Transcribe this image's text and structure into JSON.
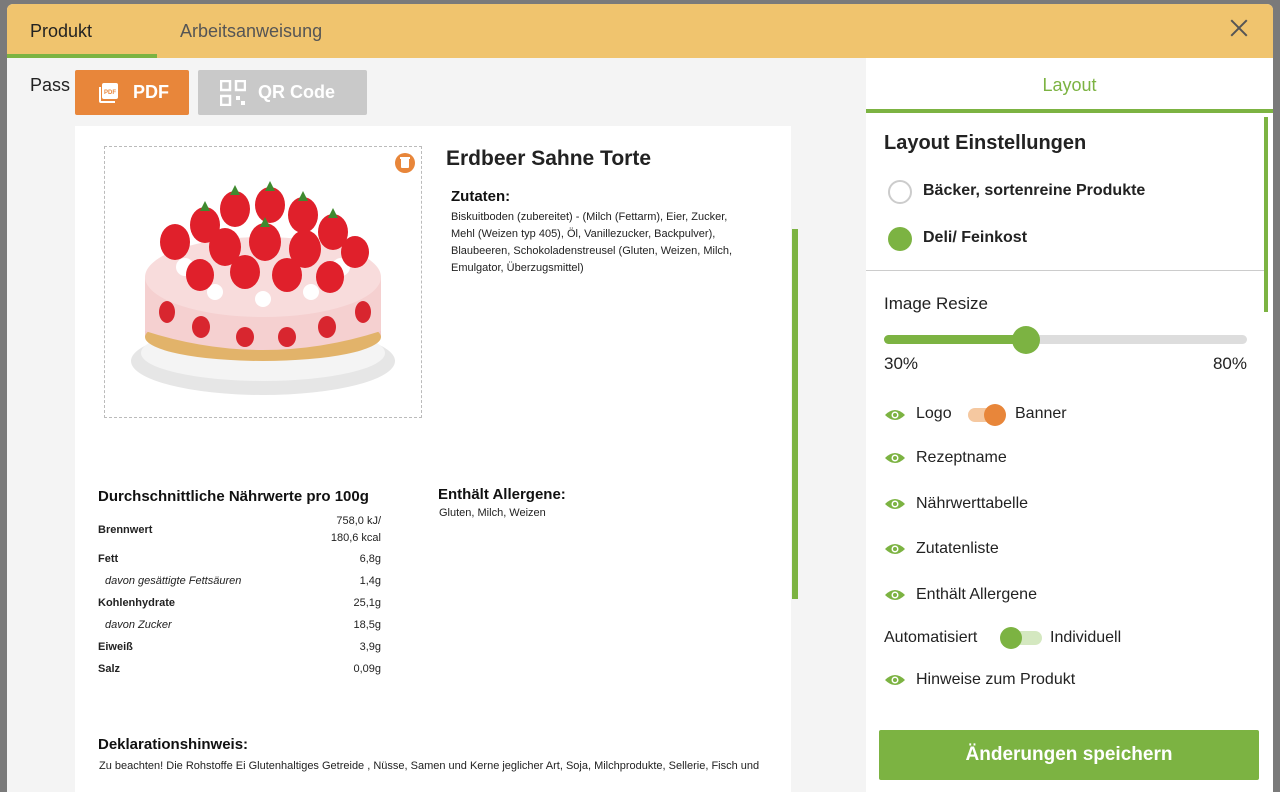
{
  "tabs": {
    "product_pass": "Produkt Pass",
    "work_instruction": "Arbeitsanweisung"
  },
  "toolbar": {
    "pdf_label": "PDF",
    "qr_label": "QR Code"
  },
  "document": {
    "title": "Erdbeer Sahne Torte",
    "ingredients_heading": "Zutaten:",
    "ingredients_text": "Biskuitboden (zubereitet) - (Milch (Fettarm), Eier, Zucker, Mehl (Weizen typ 405), Öl, Vanillezucker, Backpulver), Blaubeeren, Schokoladenstreusel (Gluten, Weizen, Milch, Emulgator, Überzugsmittel)",
    "nutrition_heading": "Durchschnittliche Nährwerte pro 100g",
    "nutrition_rows": [
      {
        "label": "Brennwert",
        "value": "758,0 kJ/\n180,6 kcal",
        "sub": false
      },
      {
        "label": "Fett",
        "value": "6,8g",
        "sub": false
      },
      {
        "label": "davon gesättigte Fettsäuren",
        "value": "1,4g",
        "sub": true
      },
      {
        "label": "Kohlenhydrate",
        "value": "25,1g",
        "sub": false
      },
      {
        "label": "davon Zucker",
        "value": "18,5g",
        "sub": true
      },
      {
        "label": "Eiweiß",
        "value": "3,9g",
        "sub": false
      },
      {
        "label": "Salz",
        "value": "0,09g",
        "sub": false
      }
    ],
    "allergens_heading": "Enthält Allergene:",
    "allergens_text": "Gluten, Milch, Weizen",
    "declaration_heading": "Deklarationshinweis:",
    "declaration_text": "Zu beachten! Die Rohstoffe Ei Glutenhaltiges Getreide , Nüsse, Samen und Kerne jeglicher Art, Soja, Milchprodukte, Sellerie, Fisch und"
  },
  "panel": {
    "tab_label": "Layout",
    "section_title": "Layout Einstellungen",
    "layout_options": [
      {
        "label": "Bäcker, sortenreine Produkte",
        "selected": false
      },
      {
        "label": "Deli/ Feinkost",
        "selected": true
      }
    ],
    "image_resize": {
      "label": "Image Resize",
      "min_label": "30%",
      "max_label": "80%",
      "value_fraction": 0.39
    },
    "logo_label": "Logo",
    "banner_label": "Banner",
    "visibility_items": [
      "Rezeptname",
      "Nährwerttabelle",
      "Zutatenliste",
      "Enthält Allergene"
    ],
    "auto_label": "Automatisiert",
    "individual_label": "Individuell",
    "notes_label": "Hinweise zum Produkt",
    "save_label": "Änderungen speichern"
  },
  "colors": {
    "accent_green": "#7cb342",
    "accent_orange": "#e8863a",
    "topbar": "#f0c46e"
  }
}
